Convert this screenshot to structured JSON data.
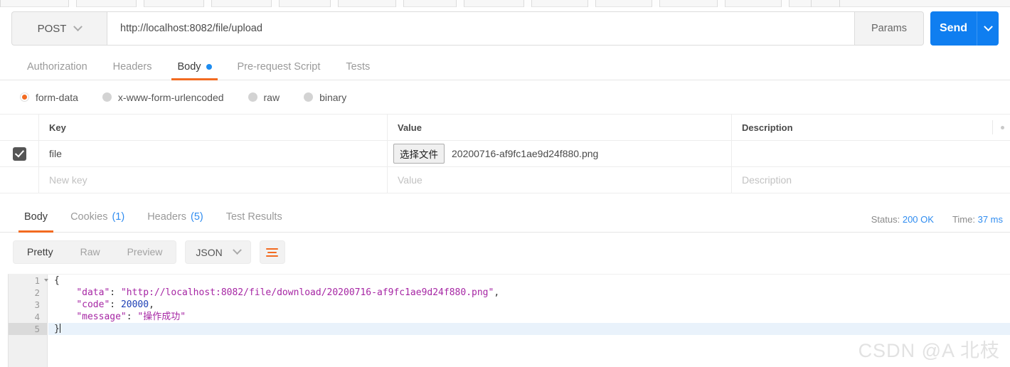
{
  "request": {
    "method": "POST",
    "url": "http://localhost:8082/file/upload",
    "params_label": "Params",
    "send_label": "Send",
    "tabs": [
      {
        "label": "Authorization",
        "active": false,
        "dot": false
      },
      {
        "label": "Headers",
        "active": false,
        "dot": false
      },
      {
        "label": "Body",
        "active": true,
        "dot": true
      },
      {
        "label": "Pre-request Script",
        "active": false,
        "dot": false
      },
      {
        "label": "Tests",
        "active": false,
        "dot": false
      }
    ]
  },
  "body_types": [
    {
      "label": "form-data",
      "selected": true
    },
    {
      "label": "x-www-form-urlencoded",
      "selected": false
    },
    {
      "label": "raw",
      "selected": false
    },
    {
      "label": "binary",
      "selected": false
    }
  ],
  "form_table": {
    "headers": {
      "key": "Key",
      "value": "Value",
      "description": "Description"
    },
    "rows": [
      {
        "checked": true,
        "key": "file",
        "file_button": "选择文件",
        "file_name": "20200716-af9fc1ae9d24f880.png",
        "description": ""
      }
    ],
    "new_row": {
      "key_placeholder": "New key",
      "value_placeholder": "Value",
      "description_placeholder": "Description"
    }
  },
  "response": {
    "tabs": [
      {
        "label": "Body",
        "count": "",
        "active": true
      },
      {
        "label": "Cookies",
        "count": "(1)",
        "active": false
      },
      {
        "label": "Headers",
        "count": "(5)",
        "active": false
      },
      {
        "label": "Test Results",
        "count": "",
        "active": false
      }
    ],
    "status_label": "Status:",
    "status_value": "200 OK",
    "time_label": "Time:",
    "time_value": "37 ms",
    "view_modes": [
      {
        "label": "Pretty",
        "active": true
      },
      {
        "label": "Raw",
        "active": false
      },
      {
        "label": "Preview",
        "active": false
      }
    ],
    "format": "JSON",
    "code_lines": [
      {
        "num": "1",
        "fold": true,
        "current": false
      },
      {
        "num": "2",
        "fold": false,
        "current": false
      },
      {
        "num": "3",
        "fold": false,
        "current": false
      },
      {
        "num": "4",
        "fold": false,
        "current": false
      },
      {
        "num": "5",
        "fold": false,
        "current": true
      }
    ],
    "json": {
      "open_brace": "{",
      "data_key": "\"data\"",
      "data_value": "\"http://localhost:8082/file/download/20200716-af9fc1ae9d24f880.png\"",
      "code_key": "\"code\"",
      "code_value": "20000",
      "message_key": "\"message\"",
      "message_value": "\"操作成功\"",
      "close_brace": "}",
      "colon": ": ",
      "comma": ","
    }
  },
  "watermark": "CSDN @A 北枝",
  "colors": {
    "accent_orange": "#f26b21",
    "accent_blue": "#0f7ef0",
    "link_blue": "#2f8cf0",
    "json_key": "#a626a4",
    "json_number": "#1d3fb5"
  }
}
